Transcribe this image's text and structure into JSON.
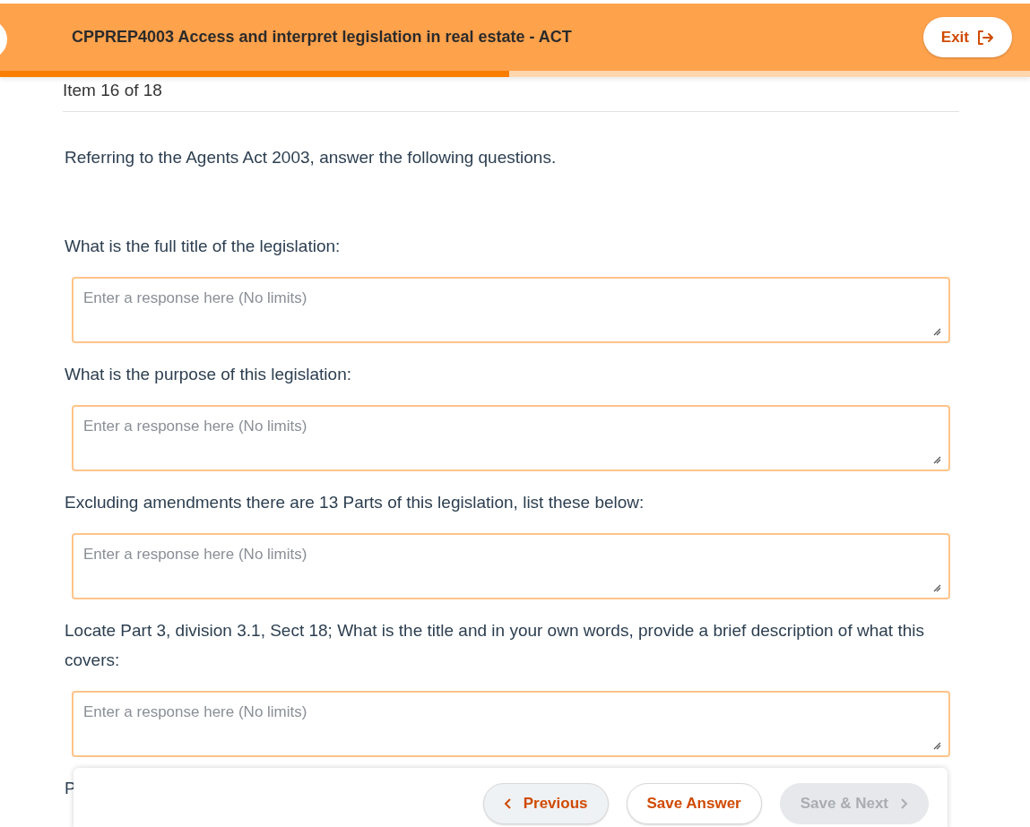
{
  "header": {
    "title": "CPPREP4003 Access and interpret legislation in real estate - ACT",
    "exit_label": "Exit"
  },
  "progress": {
    "level": 0.494
  },
  "item_counter": "Item 16 of 18",
  "intro": "Referring to the Agents Act 2003, answer the following questions.",
  "questions": [
    {
      "text": "What is the full title of the legislation:",
      "placeholder": "Enter a response here (No limits)"
    },
    {
      "text": "What is the purpose of this legislation:",
      "placeholder": "Enter a response here (No limits)"
    },
    {
      "text": "Excluding amendments there are 13 Parts of this legislation, list these below:",
      "placeholder": "Enter a response here (No limits)"
    },
    {
      "text": "Locate Part 3, division 3.1, Sect 18; What is the title and in your own words, provide a brief description of what this covers:",
      "placeholder": "Enter a response here (No limits)"
    },
    {
      "text": "P"
    }
  ],
  "footer": {
    "buttons": [
      {
        "label": "Previous",
        "kind": "previous",
        "disabled": false
      },
      {
        "label": "Save Answer",
        "kind": "save",
        "disabled": false
      },
      {
        "label": "Save & Next",
        "kind": "next",
        "disabled": true
      }
    ]
  }
}
